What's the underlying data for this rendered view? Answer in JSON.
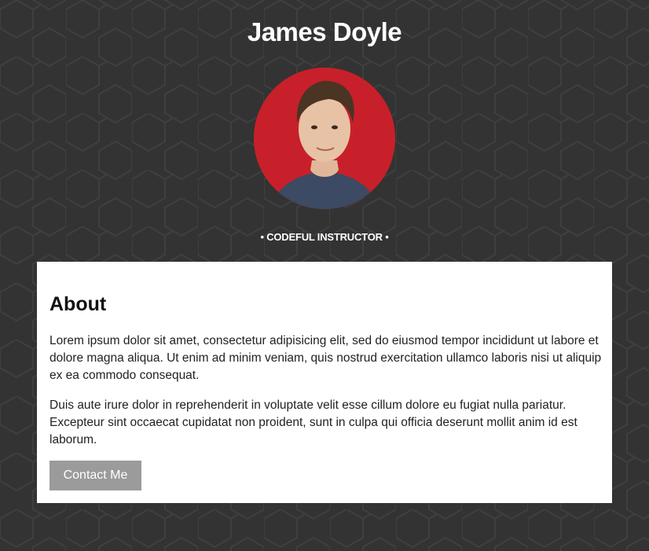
{
  "profile": {
    "name": "James Doyle",
    "role": "• CODEFUL INSTRUCTOR •",
    "avatar_icon": "person-photo"
  },
  "about": {
    "heading": "About",
    "paragraph1": "Lorem ipsum dolor sit amet, consectetur adipisicing elit, sed do eiusmod tempor incididunt ut labore et dolore magna aliqua. Ut enim ad minim veniam, quis nostrud exercitation ullamco laboris nisi ut aliquip ex ea commodo consequat.",
    "paragraph2": "Duis aute irure dolor in reprehenderit in voluptate velit esse cillum dolore eu fugiat nulla pariatur. Excepteur sint occaecat cupidatat non proident, sunt in culpa qui officia deserunt mollit anim id est laborum.",
    "contact_label": "Contact Me"
  },
  "colors": {
    "background": "#333333",
    "avatar_bg": "#c8202a",
    "button": "#9b9b9b",
    "card": "#ffffff"
  }
}
